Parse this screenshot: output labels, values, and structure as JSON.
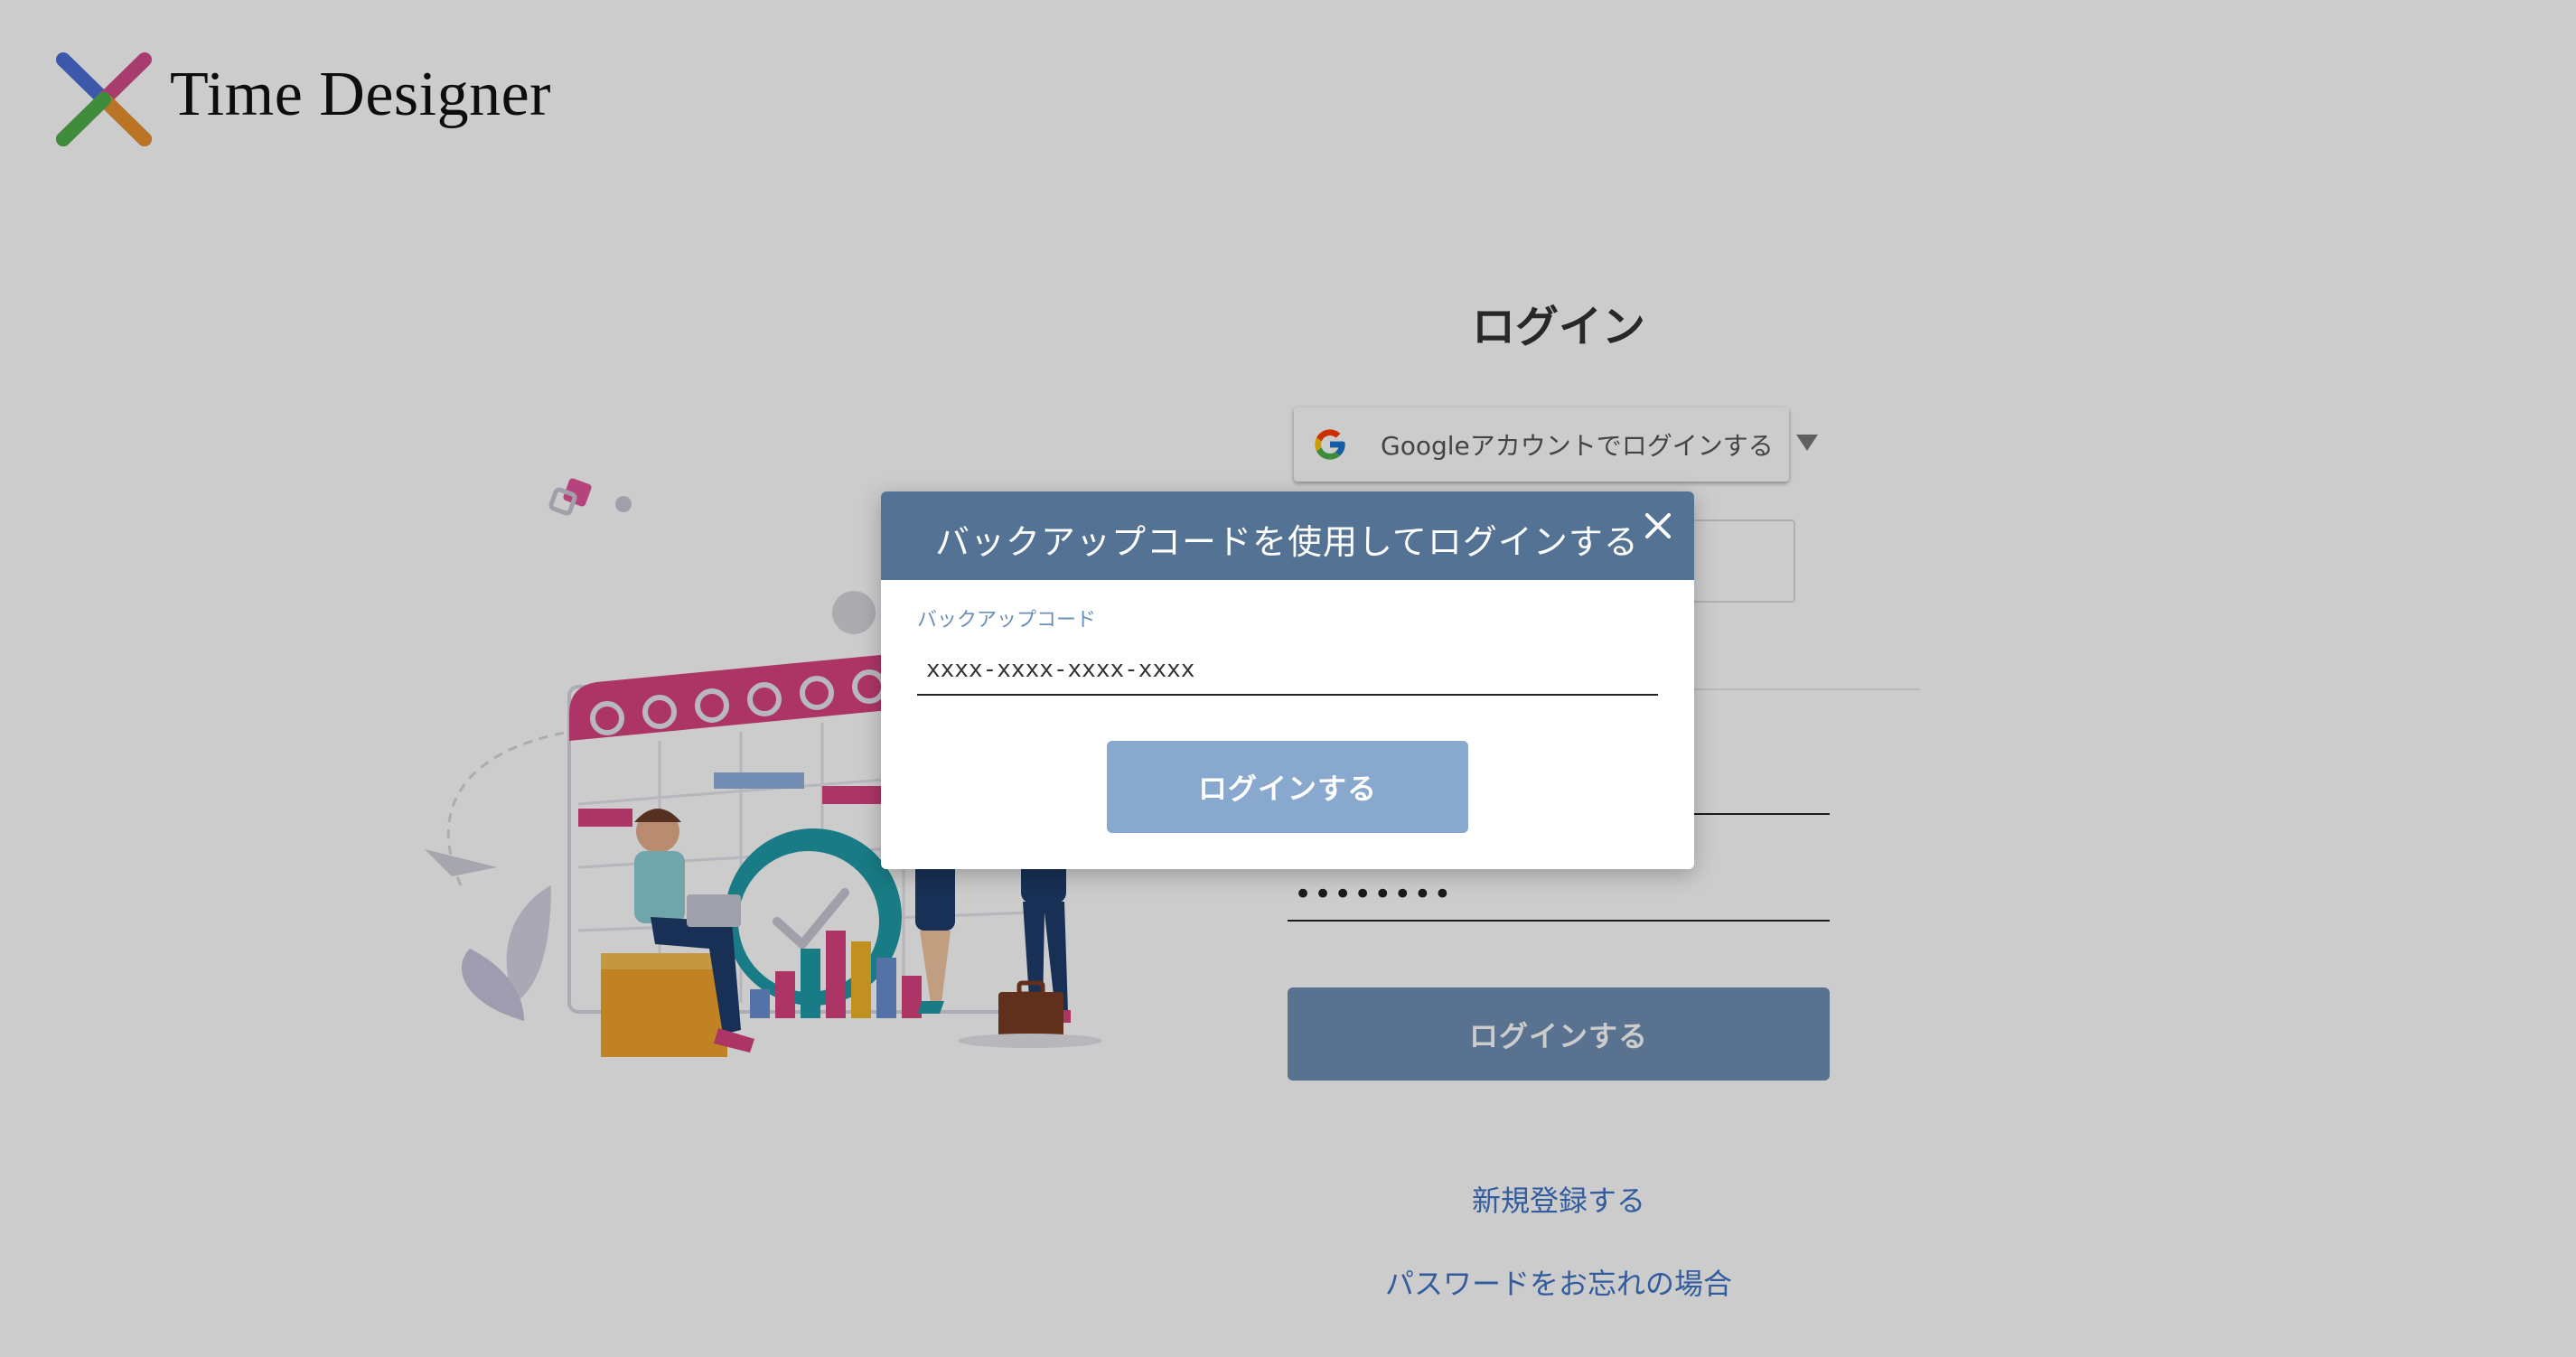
{
  "app": {
    "title": "Time Designer"
  },
  "login": {
    "title": "ログイン",
    "google_button_label": "Googleアカウントでログインする",
    "password_value": "••••••••",
    "submit_label": "ログインする",
    "signup_link": "新規登録する",
    "forgot_link": "パスワードをお忘れの場合"
  },
  "modal": {
    "title": "バックアップコードを使用してログインする",
    "field_label": "バックアップコード",
    "code_value": "xxxx-xxxx-xxxx-xxxx",
    "submit_label": "ログインする"
  },
  "colors": {
    "modal_header": "#547394",
    "modal_button": "#88a8cd",
    "login_button": "#6e8fb5",
    "link": "#3f74c6",
    "overlay": "rgba(0,0,0,0.2)"
  },
  "icons": {
    "logo": "time-designer-x-logo-icon",
    "google": "google-g-icon",
    "caret": "caret-down-icon",
    "close": "close-icon"
  }
}
